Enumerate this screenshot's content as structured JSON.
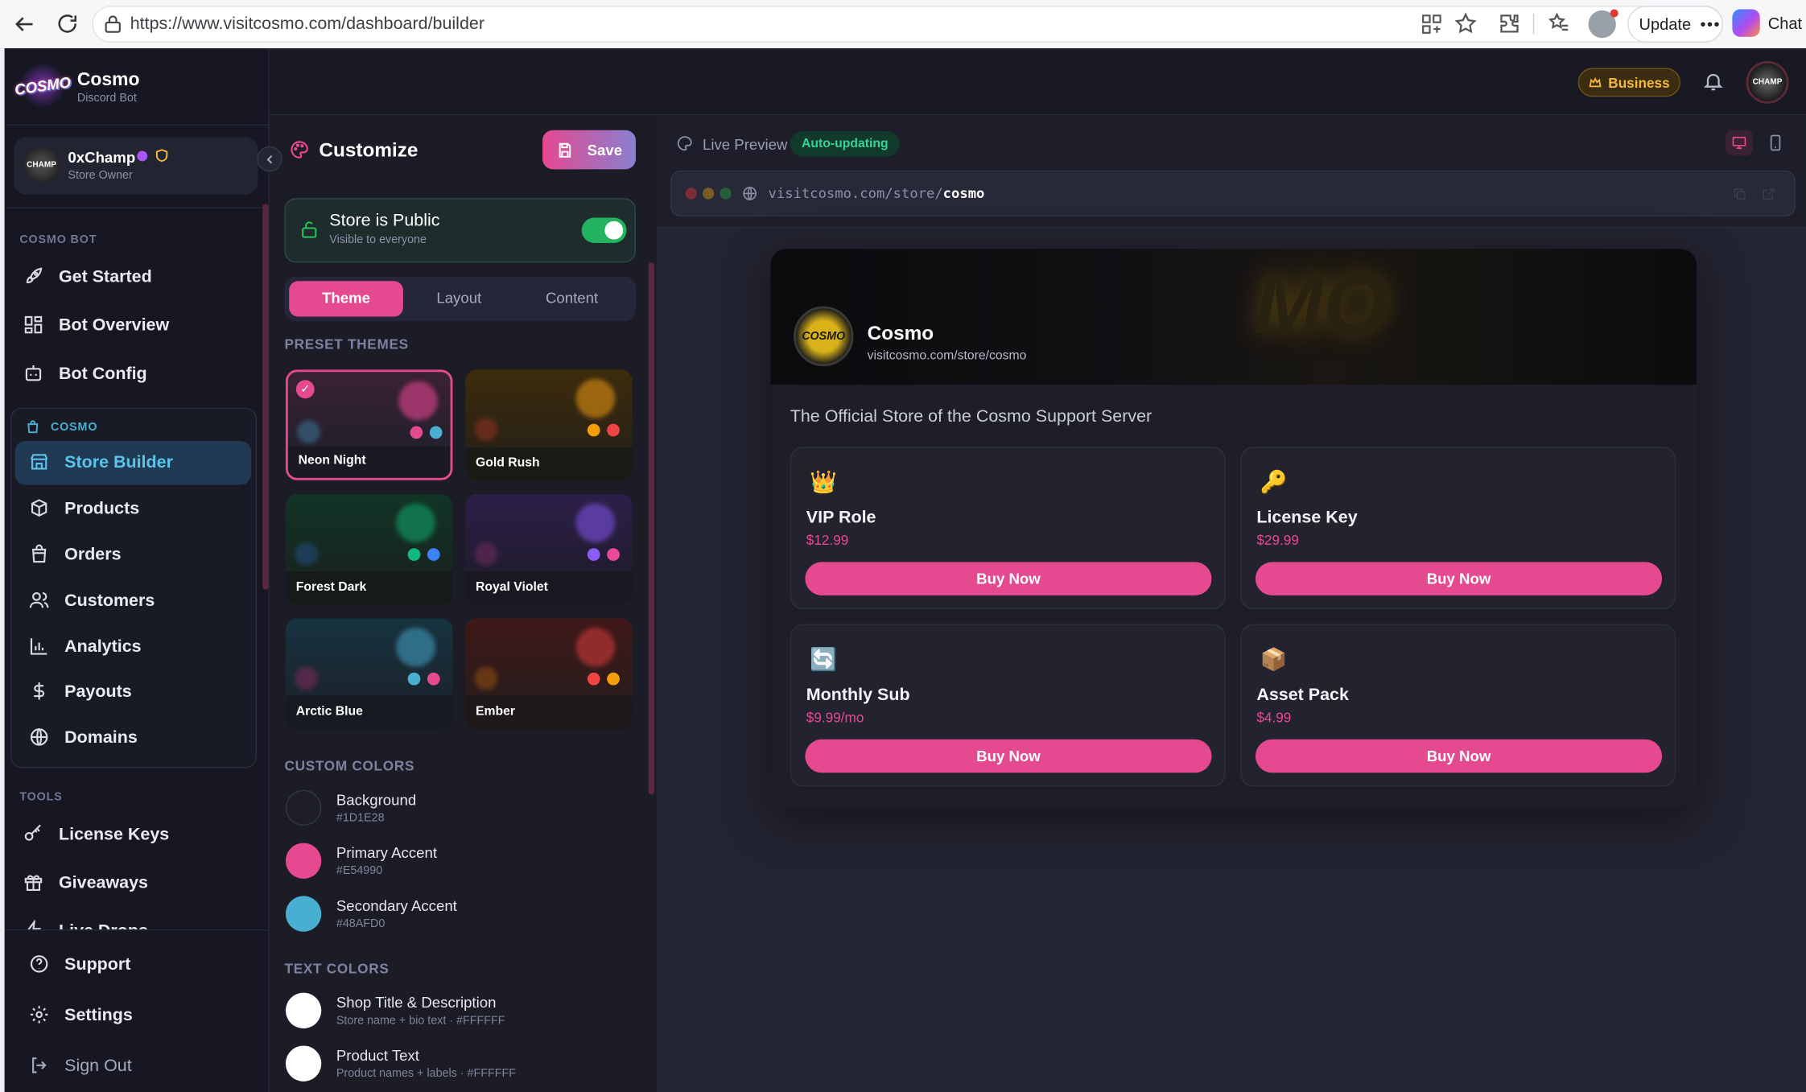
{
  "browser": {
    "url": "https://www.visitcosmo.com/dashboard/builder",
    "update_label": "Update",
    "chat_label": "Chat"
  },
  "brand": {
    "logo_text": "COSMO",
    "name": "Cosmo",
    "subtitle": "Discord Bot"
  },
  "user": {
    "avatar_text": "CHAMP",
    "name": "0xChamp",
    "role": "Store Owner"
  },
  "sidebar": {
    "section_bot": "COSMO BOT",
    "bot_items": [
      {
        "label": "Get Started",
        "icon": "rocket-icon"
      },
      {
        "label": "Bot Overview",
        "icon": "grid-icon"
      },
      {
        "label": "Bot Config",
        "icon": "robot-icon"
      }
    ],
    "section_store": "COSMO",
    "store_items": [
      {
        "label": "Store Builder",
        "icon": "store-icon",
        "active": true
      },
      {
        "label": "Products",
        "icon": "box-icon"
      },
      {
        "label": "Orders",
        "icon": "bag-icon"
      },
      {
        "label": "Customers",
        "icon": "users-icon"
      },
      {
        "label": "Analytics",
        "icon": "chart-icon"
      },
      {
        "label": "Payouts",
        "icon": "dollar-icon"
      },
      {
        "label": "Domains",
        "icon": "globe-icon"
      }
    ],
    "section_tools": "TOOLS",
    "tool_items": [
      {
        "label": "License Keys",
        "icon": "key-icon"
      },
      {
        "label": "Giveaways",
        "icon": "gift-icon"
      },
      {
        "label": "Live Drops",
        "icon": "zap-icon"
      }
    ],
    "bottom_items": [
      {
        "label": "Support",
        "icon": "help-icon"
      },
      {
        "label": "Settings",
        "icon": "gear-icon"
      },
      {
        "label": "Sign Out",
        "icon": "logout-icon"
      }
    ]
  },
  "topbar": {
    "plan_badge": "Business",
    "avatar_text": "CHAMP"
  },
  "customize": {
    "title": "Customize",
    "save_label": "Save",
    "public_title": "Store is Public",
    "public_sub": "Visible to everyone",
    "public_on": true,
    "tabs": [
      "Theme",
      "Layout",
      "Content"
    ],
    "active_tab": "Theme",
    "preset_label": "PRESET THEMES",
    "themes": [
      {
        "name": "Neon Night",
        "c1": "#e54990",
        "c2": "#48afd0",
        "bg": "#2a1f2e",
        "selected": true
      },
      {
        "name": "Gold Rush",
        "c1": "#f59e0b",
        "c2": "#ef4444",
        "bg": "#2b2314"
      },
      {
        "name": "Forest Dark",
        "c1": "#10b981",
        "c2": "#3b82f6",
        "bg": "#162a24"
      },
      {
        "name": "Royal Violet",
        "c1": "#8b5cf6",
        "c2": "#ec4899",
        "bg": "#251d36"
      },
      {
        "name": "Arctic Blue",
        "c1": "#48afd0",
        "c2": "#e54990",
        "bg": "#1b2a33"
      },
      {
        "name": "Ember",
        "c1": "#ef4444",
        "c2": "#f59e0b",
        "bg": "#2e1a1a"
      }
    ],
    "custom_colors_label": "CUSTOM COLORS",
    "custom_colors": [
      {
        "label": "Background",
        "hex": "#1D1E28",
        "color": "#1d1e28"
      },
      {
        "label": "Primary Accent",
        "hex": "#E54990",
        "color": "#e54990"
      },
      {
        "label": "Secondary Accent",
        "hex": "#48AFD0",
        "color": "#48afd0"
      }
    ],
    "text_colors_label": "TEXT COLORS",
    "text_colors": [
      {
        "label": "Shop Title & Description",
        "sub": "Store name + bio text · #FFFFFF",
        "color": "#ffffff"
      },
      {
        "label": "Product Text",
        "sub": "Product names + labels · #FFFFFF",
        "color": "#ffffff"
      }
    ]
  },
  "preview": {
    "label": "Live Preview",
    "status": "Auto-updating",
    "url_prefix": "visitcosmo.com/store/",
    "url_slug": "cosmo",
    "store_logo_text": "COSMO",
    "store_name": "Cosmo",
    "store_url": "visitcosmo.com/store/cosmo",
    "banner_text": "MO",
    "description": "The Official Store of the Cosmo Support Server",
    "products": [
      {
        "emoji": "👑",
        "name": "VIP Role",
        "price": "$12.99",
        "button": "Buy Now"
      },
      {
        "emoji": "🔑",
        "name": "License Key",
        "price": "$29.99",
        "button": "Buy Now"
      },
      {
        "emoji": "🔄",
        "name": "Monthly Sub",
        "price": "$9.99/mo",
        "button": "Buy Now"
      },
      {
        "emoji": "📦",
        "name": "Asset Pack",
        "price": "$4.99",
        "button": "Buy Now"
      }
    ]
  },
  "colors": {
    "accent": "#e54990",
    "accent_blue": "#48afd0",
    "success": "#22c55e",
    "gold": "#f5b83d"
  }
}
